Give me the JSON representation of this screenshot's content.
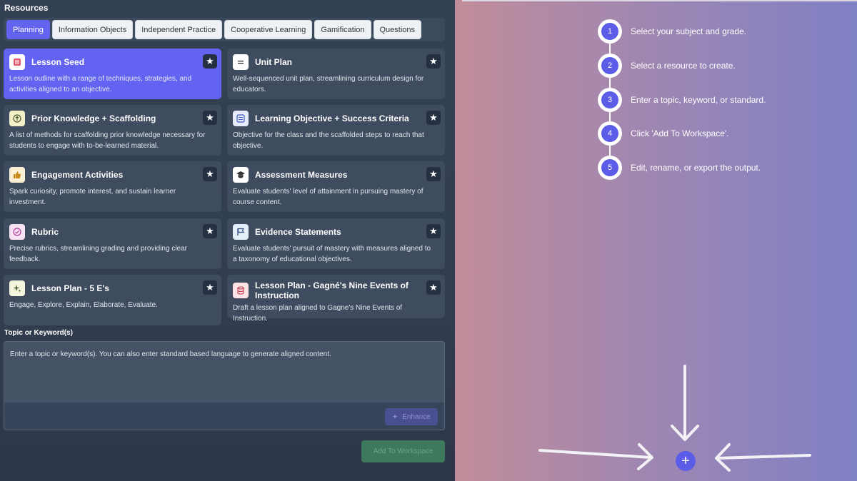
{
  "resources_title": "Resources",
  "tabs": [
    {
      "label": "Planning"
    },
    {
      "label": "Information Objects"
    },
    {
      "label": "Independent Practice"
    },
    {
      "label": "Cooperative Learning"
    },
    {
      "label": "Gamification"
    },
    {
      "label": "Questions"
    }
  ],
  "cards": [
    {
      "title": "Lesson Seed",
      "desc": "Lesson outline with a range of techniques, strategies, and activities aligned to an objective.",
      "icon": "list-icon"
    },
    {
      "title": "Unit Plan",
      "desc": "Well-sequenced unit plan, streamlining curriculum design for educators.",
      "icon": "document-lines-icon"
    },
    {
      "title": "Prior Knowledge + Scaffolding",
      "desc": "A list of methods for scaffolding prior knowledge necessary for students to engage with to-be-learned material.",
      "icon": "arrow-up-circle-icon"
    },
    {
      "title": "Learning Objective + Success Criteria",
      "desc": "Objective for the class and the scaffolded steps to reach that objective.",
      "icon": "checklist-icon"
    },
    {
      "title": "Engagement Activities",
      "desc": "Spark curiosity, promote interest, and sustain learner investment.",
      "icon": "thumbs-up-icon"
    },
    {
      "title": "Assessment Measures",
      "desc": "Evaluate students' level of attainment in pursuing mastery of course content.",
      "icon": "graduation-cap-icon"
    },
    {
      "title": "Rubric",
      "desc": "Precise rubrics, streamlining grading and providing clear feedback.",
      "icon": "check-circle-icon"
    },
    {
      "title": "Evidence Statements",
      "desc": "Evaluate students' pursuit of mastery with measures aligned to a taxonomy of educational objectives.",
      "icon": "flag-icon"
    },
    {
      "title": "Lesson Plan - 5 E's",
      "desc": "Engage, Explore, Explain, Elaborate, Evaluate.",
      "icon": "sparkle-icon"
    },
    {
      "title": "Lesson Plan - Gagné's Nine Events of Instruction",
      "desc": "Draft a lesson plan aligned to Gagne's Nine Events of Instruction.",
      "icon": "database-icon"
    }
  ],
  "topic": {
    "label": "Topic or Keyword(s)",
    "placeholder": "Enter a topic or keyword(s).  You can also enter standard based language to generate aligned content.",
    "enhance_label": "Enhance"
  },
  "add_to_workspace_label": "Add To Workspace",
  "steps": [
    {
      "num": "1",
      "text": "Select your subject and grade."
    },
    {
      "num": "2",
      "text": "Select a resource to create."
    },
    {
      "num": "3",
      "text": "Enter a topic, keyword, or standard."
    },
    {
      "num": "4",
      "text": "Click 'Add To Workspace'."
    },
    {
      "num": "5",
      "text": "Edit, rename, or export the output."
    }
  ],
  "plus_symbol": "+",
  "star_symbol": "★",
  "colors": {
    "accent": "#6363f1",
    "add_button": "#3c7a5b",
    "step_circle": "#5b5ce8"
  }
}
